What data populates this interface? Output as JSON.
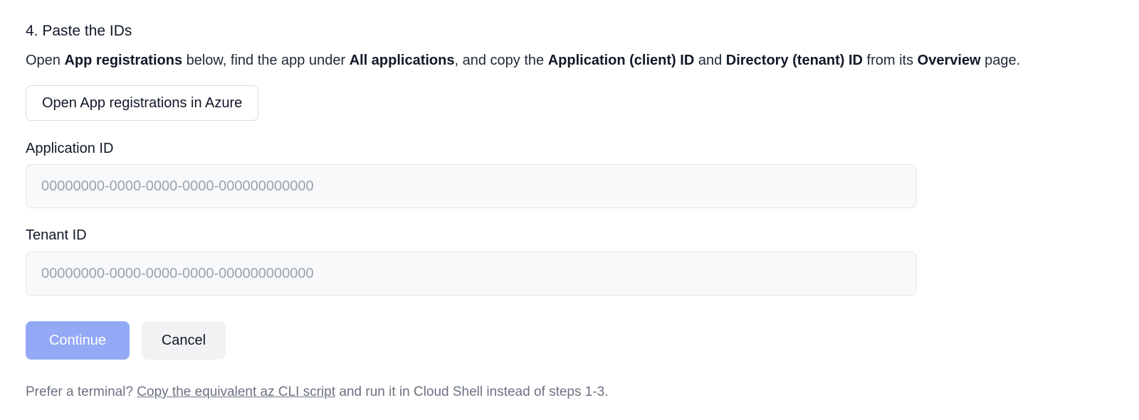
{
  "step": {
    "title": "4. Paste the IDs"
  },
  "instructions": {
    "t1": "Open ",
    "b1": "App registrations",
    "t2": " below, find the app under ",
    "b2": "All applications",
    "t3": ", and copy the ",
    "b3": "Application (client) ID",
    "t4": " and ",
    "b4": "Directory (tenant) ID",
    "t5": " from its ",
    "b5": "Overview",
    "t6": " page."
  },
  "open_azure_button": {
    "label": "Open App registrations in Azure"
  },
  "fields": {
    "application_id": {
      "label": "Application ID",
      "value": "",
      "placeholder": "00000000-0000-0000-0000-000000000000"
    },
    "tenant_id": {
      "label": "Tenant ID",
      "value": "",
      "placeholder": "00000000-0000-0000-0000-000000000000"
    }
  },
  "actions": {
    "continue_label": "Continue",
    "cancel_label": "Cancel",
    "continue_color": "#94a9f6",
    "cancel_color": "#f1f2f4"
  },
  "terminal_note": {
    "prefix": "Prefer a terminal? ",
    "link": "Copy the equivalent az CLI script",
    "suffix": " and run it in Cloud Shell instead of steps 1-3."
  }
}
